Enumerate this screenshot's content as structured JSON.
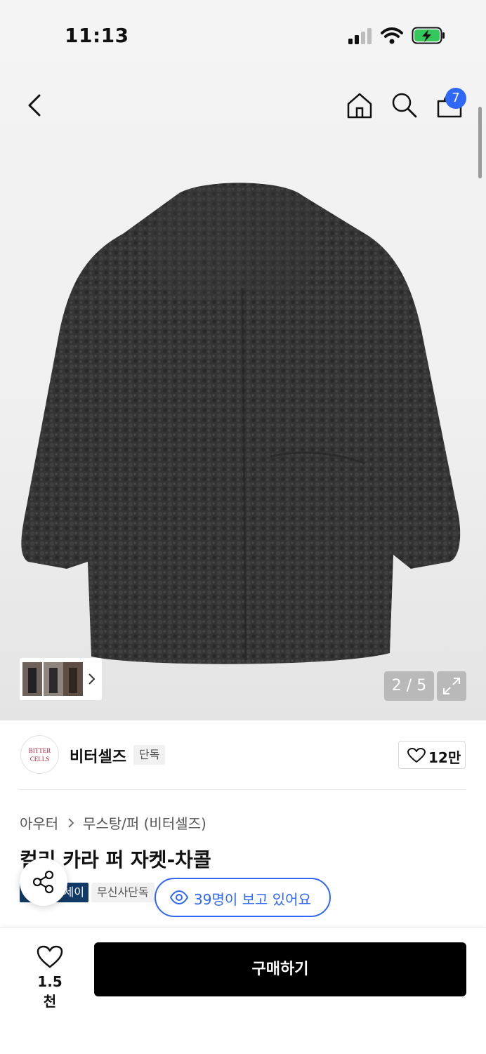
{
  "status_bar": {
    "time": "11:13",
    "icons": [
      "cellular-signal-icon",
      "wifi-icon",
      "battery-charging-icon"
    ],
    "battery_color": "#34c759"
  },
  "header": {
    "icons": [
      "back-arrow-icon",
      "home-icon",
      "search-icon",
      "cart-icon"
    ],
    "cart_badge": "7",
    "badge_color": "#2f67f6"
  },
  "gallery": {
    "image": "black curly faux fur collared jacket",
    "page_indicator": "2 / 5",
    "current_page": 2,
    "total_pages": 5
  },
  "brand": {
    "logo_line1": "BITTER",
    "logo_line2": "CELLS",
    "name": "비터셀즈",
    "tag": "단독",
    "like_count": "12만"
  },
  "breadcrumb": {
    "category": "아우터",
    "subcategory": "무스탕/퍼 (비터셀즈)"
  },
  "product": {
    "title": "컬리 카라 퍼 자켓-차콜",
    "tag_dark": "세이",
    "tag_light": "무신사단독"
  },
  "viewers": {
    "text": "39명이 보고 있어요"
  },
  "bottom_bar": {
    "wishlist_count": "1.5천",
    "buy_label": "구매하기"
  }
}
